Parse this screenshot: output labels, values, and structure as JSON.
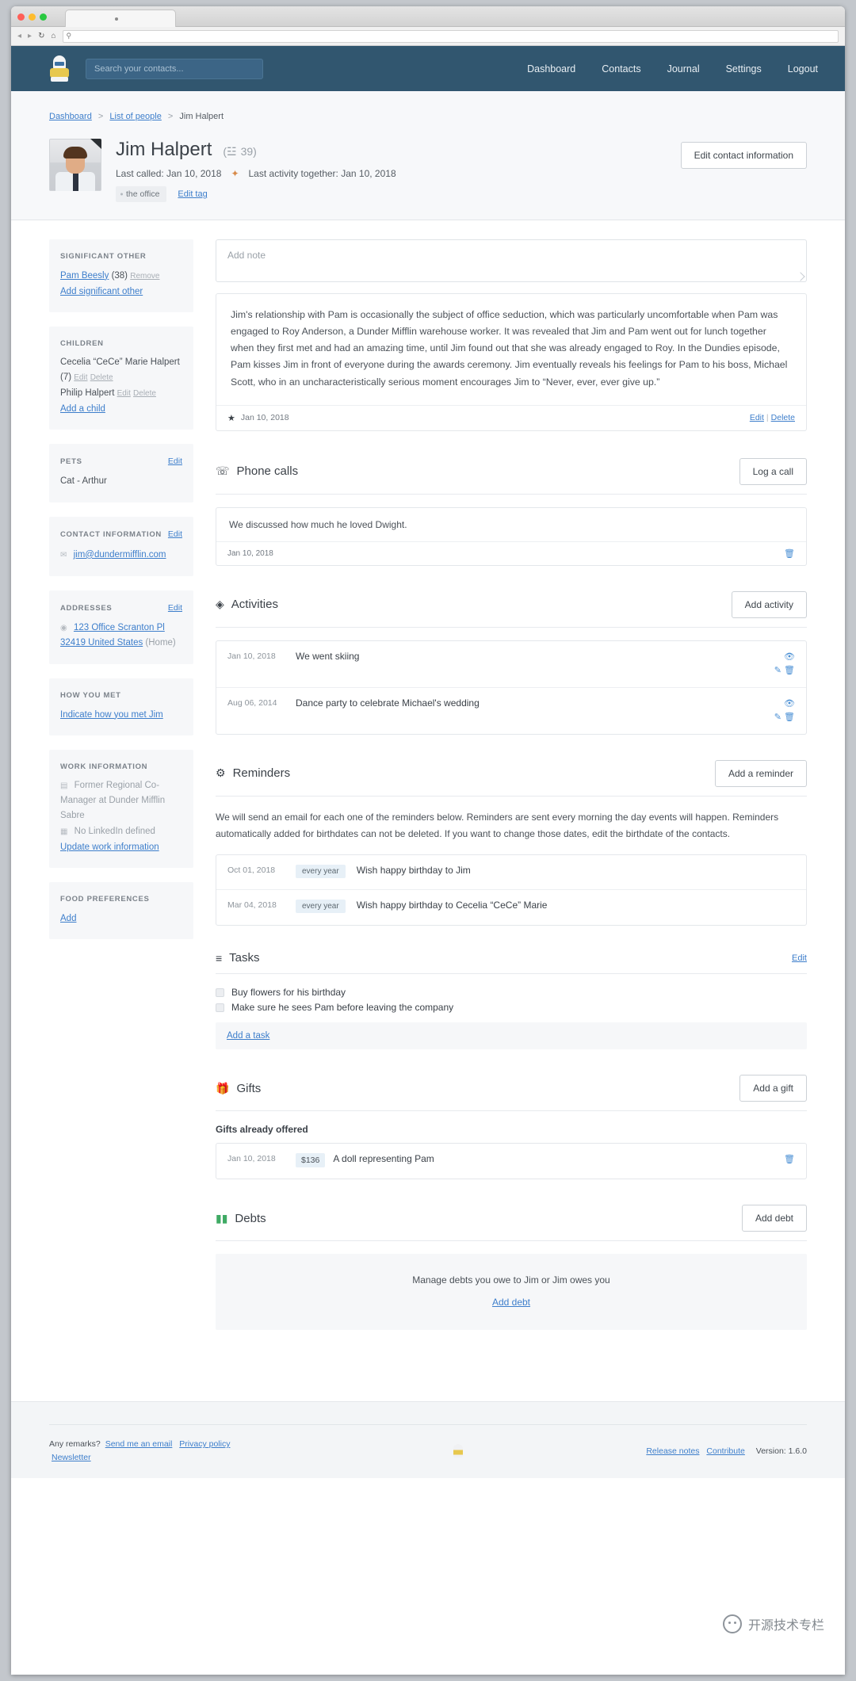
{
  "browser": {
    "url_placeholder": "",
    "search_icon": "search-icon",
    "back_icon": "◂",
    "forward_icon": "▸",
    "reload_icon": "↻",
    "home_icon": "⌂"
  },
  "navbar": {
    "logo_name": "monica-logo",
    "search_placeholder": "Search your contacts...",
    "links": [
      {
        "label": "Dashboard"
      },
      {
        "label": "Contacts"
      },
      {
        "label": "Journal"
      },
      {
        "label": "Settings"
      },
      {
        "label": "Logout"
      }
    ]
  },
  "breadcrumb": {
    "dashboard": "Dashboard",
    "list_of_people": "List of people",
    "current": "Jim Halpert",
    "separator": ">"
  },
  "profile": {
    "name": "Jim Halpert",
    "age": "39",
    "cake_icon": "🎂",
    "last_called_label": "Last called: Jan 10, 2018",
    "separator_icon": "✦",
    "last_activity_label": "Last activity together: Jan 10, 2018",
    "tag": "the office",
    "edit_tag": "Edit tag",
    "edit_button": "Edit contact information"
  },
  "sidebar": {
    "significant_other": {
      "title": "Significant other",
      "person": "Pam Beesly",
      "age": "(38)",
      "remove": "Remove",
      "add_link": "Add significant other"
    },
    "children": {
      "title": "Children",
      "items": [
        {
          "name": "Cecelia “CeCe” Marie Halpert (7)",
          "edit": "Edit",
          "delete": "Delete"
        },
        {
          "name": "Philip Halpert",
          "edit": "Edit",
          "delete": "Delete"
        }
      ],
      "add_link": "Add a child"
    },
    "pets": {
      "title": "Pets",
      "edit": "Edit",
      "items": [
        "Cat - Arthur"
      ]
    },
    "contact_information": {
      "title": "Contact information",
      "edit": "Edit",
      "email": "jim@dundermifflin.com",
      "email_icon": "envelope-icon"
    },
    "addresses": {
      "title": "Addresses",
      "edit": "Edit",
      "line1": "123 Office Scranton Pl",
      "line2": "32419 United States",
      "kind": "(Home)",
      "globe_icon": "globe-icon"
    },
    "how_you_met": {
      "title": "How you met",
      "link": "Indicate how you met Jim"
    },
    "work_information": {
      "title": "Work information",
      "job": "Former Regional Co-Manager at Dunder Mifflin Sabre",
      "job_icon": "briefcase-icon",
      "linkedin": "No LinkedIn defined",
      "linkedin_icon": "linkedin-icon",
      "update_link": "Update work information"
    },
    "food_preferences": {
      "title": "Food preferences",
      "add_link": "Add"
    }
  },
  "notes": {
    "add_placeholder": "Add note",
    "entry": "Jim's relationship with Pam is occasionally the subject of office seduction, which was particularly uncomfortable when Pam was engaged to Roy Anderson, a Dunder Mifflin warehouse worker. It was revealed that Jim and Pam went out for lunch together when they first met and had an amazing time, until Jim found out that she was already engaged to Roy. In the Dundies episode, Pam kisses Jim in front of everyone during the awards ceremony. Jim eventually reveals his feelings for Pam to his boss, Michael Scott, who in an uncharacteristically serious moment encourages Jim to “Never, ever, ever give up.”",
    "date": "Jan 10, 2018",
    "star_icon": "star-icon",
    "edit": "Edit",
    "delete": "Delete"
  },
  "phone_calls": {
    "title": "Phone calls",
    "icon": "phone-icon",
    "button": "Log a call",
    "entry": "We discussed how much he loved Dwight.",
    "date": "Jan 10, 2018",
    "delete_icon": "trash-icon"
  },
  "activities": {
    "title": "Activities",
    "icon": "activity-icon",
    "button": "Add activity",
    "rows": [
      {
        "date": "Jan 10, 2018",
        "label": "We went skiing",
        "view_icon": "eye-icon",
        "edit_icon": "pencil-icon",
        "delete_icon": "trash-icon"
      },
      {
        "date": "Aug 06, 2014",
        "label": "Dance party to celebrate Michael's wedding",
        "view_icon": "eye-icon",
        "edit_icon": "pencil-icon",
        "delete_icon": "trash-icon"
      }
    ]
  },
  "reminders": {
    "title": "Reminders",
    "icon": "bell-icon",
    "button": "Add a reminder",
    "description": "We will send an email for each one of the reminders below. Reminders are sent every morning the day events will happen. Reminders automatically added for birthdates can not be deleted. If you want to change those dates, edit the birthdate of the contacts.",
    "rows": [
      {
        "date": "Oct 01, 2018",
        "frequency": "every year",
        "label": "Wish happy birthday to Jim"
      },
      {
        "date": "Mar 04, 2018",
        "frequency": "every year",
        "label": "Wish happy birthday to Cecelia “CeCe” Marie"
      }
    ]
  },
  "tasks": {
    "title": "Tasks",
    "icon": "list-icon",
    "edit": "Edit",
    "items": [
      {
        "label": "Buy flowers for his birthday",
        "checked": false
      },
      {
        "label": "Make sure he sees Pam before leaving the company",
        "checked": false
      }
    ],
    "add_link": "Add a task"
  },
  "gifts": {
    "title": "Gifts",
    "icon": "gift-icon",
    "button": "Add a gift",
    "subhead": "Gifts already offered",
    "rows": [
      {
        "date": "Jan 10, 2018",
        "amount": "$136",
        "label": "A doll representing Pam",
        "delete_icon": "trash-icon"
      }
    ]
  },
  "debts": {
    "title": "Debts",
    "icon": "money-icon",
    "button": "Add debt",
    "empty_text": "Manage debts you owe to Jim or Jim owes you",
    "add_link": "Add debt"
  },
  "footer": {
    "remarks": "Any remarks?",
    "send_email": "Send me an email",
    "privacy": "Privacy policy",
    "newsletter": "Newsletter",
    "release_notes": "Release notes",
    "contribute": "Contribute",
    "version": "Version: 1.6.0",
    "logo_name": "monica-mini-logo"
  },
  "watermark": {
    "text": "开源技术专栏"
  },
  "colors": {
    "navbar": "#31566f",
    "link": "#3d7ecb",
    "text": "#4b5158",
    "muted": "#9aa1a8"
  }
}
